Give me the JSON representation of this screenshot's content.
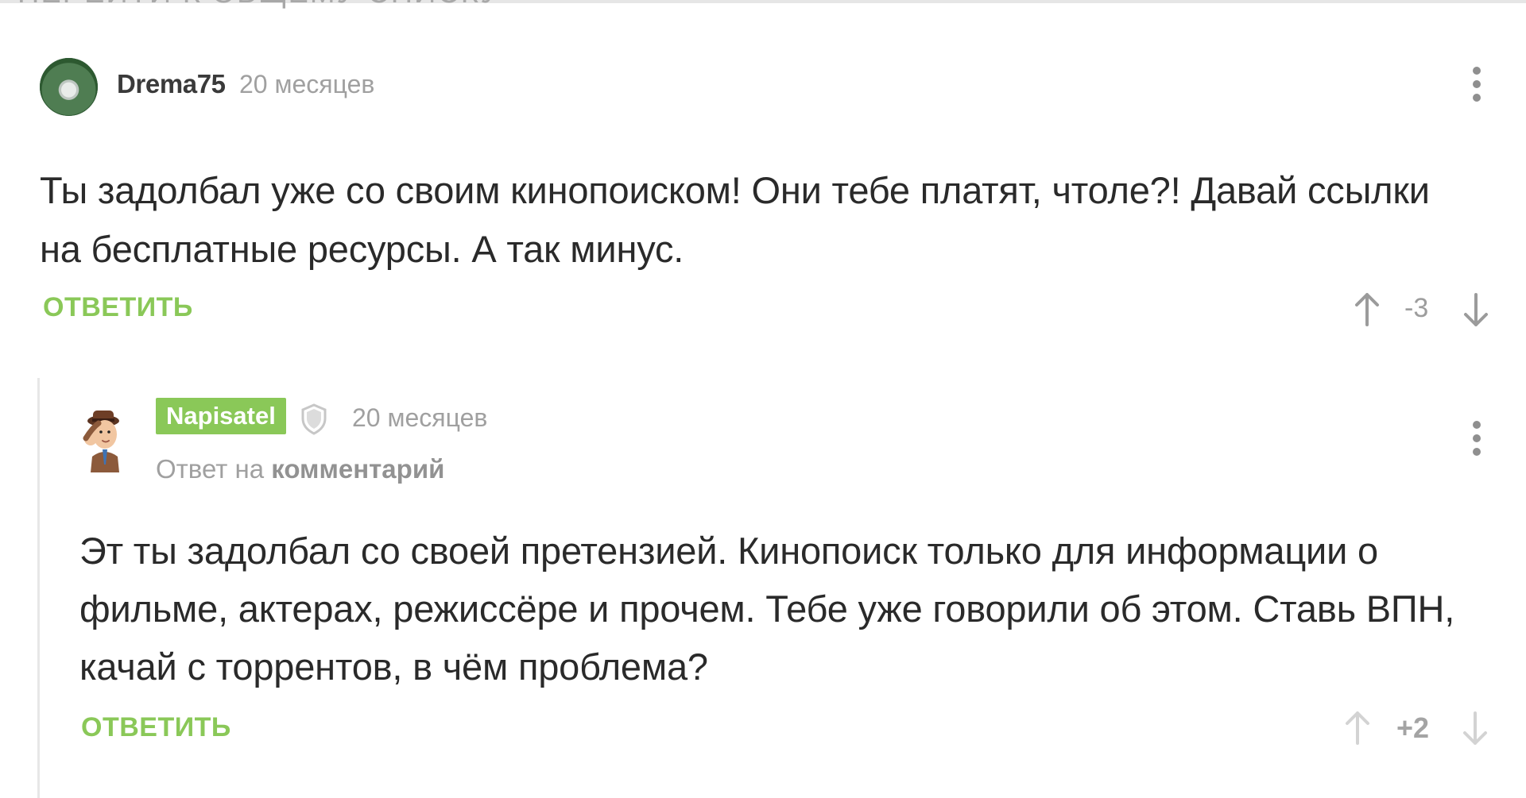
{
  "page": {
    "top_partial_text": "ПЕРЕЙТИ К ОБЩЕМУ СПИСКУ"
  },
  "comments": [
    {
      "author": "Drema75",
      "time": "20 месяцев",
      "text": "Ты задолбал уже со своим кинопоиском! Они тебе платят, чтоле?! Давай ссылки на бесплатные ресурсы. А так минус.",
      "reply_label": "ОТВЕТИТЬ",
      "score": "-3"
    },
    {
      "author": "Napisatel",
      "time": "20 месяцев",
      "reply_to_prefix": "Ответ на",
      "reply_to_link": "комментарий",
      "text": "Эт ты задолбал со своей претензией. Кинопоиск только для информации о фильме, актерах, режиссёре и прочем. Тебе уже говорили об этом. Ставь ВПН, качай с торрентов, в чём проблема?",
      "reply_label": "ОТВЕТИТЬ",
      "score": "+2"
    }
  ],
  "colors": {
    "accent": "#8ac858",
    "muted": "#a0a0a0",
    "text": "#2a2a2a"
  },
  "icons": {
    "more": "more-vertical-icon",
    "upvote": "arrow-up-icon",
    "downvote": "arrow-down-icon",
    "shield": "shield-icon"
  }
}
